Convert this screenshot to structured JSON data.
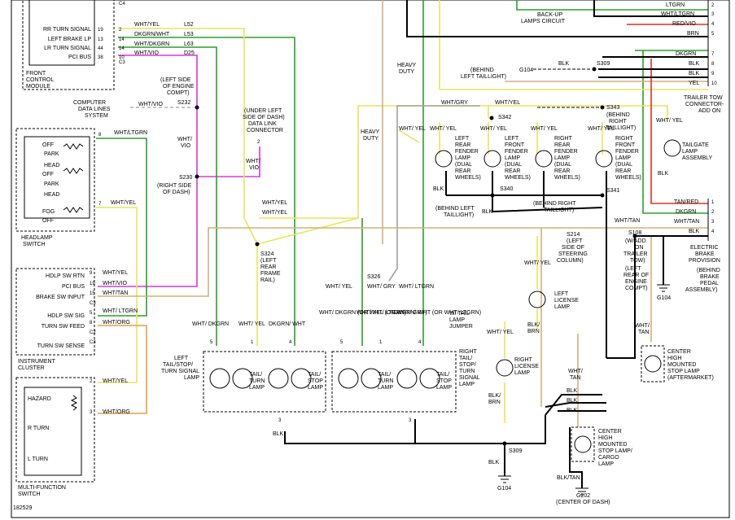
{
  "colors": {
    "wht_yel": "#e8e65a",
    "wht_grn": "#2aa02a",
    "wht_vio": "#d838d8",
    "wht_gry": "#a0a0a0",
    "wht_org": "#e8a040",
    "wht_tan": "#d2b07a",
    "red": "#e03020",
    "blk": "#000000"
  },
  "labels": {
    "front_control_module": [
      "FRONT",
      "CONTROL",
      "MODULE"
    ],
    "fcm_pins": [
      {
        "name": "RR TURN SIGNAL",
        "pin": "19",
        "num": "2"
      },
      {
        "name": "LEFT BRAKE LP",
        "pin": "13",
        "num": "14"
      },
      {
        "name": "LR TURN SIGNAL",
        "pin": "44",
        "num": "14"
      },
      {
        "name": "PCI BUS",
        "pin": "38",
        "num": "10"
      }
    ],
    "c4": "C4",
    "c3": "C3",
    "fcm_wires": [
      {
        "color": "WHT/YEL",
        "code": "L52"
      },
      {
        "color": "DKGRN/WHT",
        "code": "L53"
      },
      {
        "color": "WHT/DKGRN",
        "code": "L63"
      },
      {
        "color": "WHT/VIO",
        "code": "D25"
      }
    ],
    "left_side_engine": [
      "(LEFT SIDE",
      "OF ENGINE",
      "COMPT)"
    ],
    "s232": "S232",
    "computer_data_lines": [
      "COMPUTER",
      "DATA LINES",
      "SYSTEM"
    ],
    "wht_vio": "WHT/VIO",
    "wht_vio_stack": [
      "WHT/",
      "VIO"
    ],
    "s230": "S230",
    "right_side_dash": [
      "(RIGHT SIDE",
      "OF DASH)"
    ],
    "data_link": [
      "(UNDER LEFT",
      "SIDE OF DASH)",
      "DATA LINK",
      "CONNECTOR"
    ],
    "dlc_pin": "2",
    "heavy_duty_1": [
      "HEAVY",
      "DUTY"
    ],
    "heavy_duty_2": [
      "HEAVY",
      "DUTY"
    ],
    "backup_lamps": [
      "BACK-UP",
      "LAMPS CIRCUIT"
    ],
    "g104": "G104",
    "s309": "S309",
    "blk": "BLK",
    "behind_left_taillight": [
      "(BEHIND",
      "LEFT TAILLIGHT)"
    ],
    "wht_gry": "WHT/GRY",
    "wht_yel": "WHT/YEL",
    "s342": "S342",
    "s343": "S343",
    "behind_right_taillight": [
      "(BEHIND",
      "RIGHT",
      "TAILLIGHT)"
    ],
    "trailer_tow_connector": [
      "TRAILER TOW",
      "CONNECTOR-",
      "ADD ON"
    ],
    "trailer_pins": [
      {
        "color": "LTGRN",
        "pin": "2"
      },
      {
        "color": "WHT/LTGRN",
        "pin": "3"
      },
      {
        "color": "RED/VIO",
        "pin": "4"
      },
      {
        "color": "BRN",
        "pin": "5"
      },
      {
        "color": "DKGRN",
        "pin": "7"
      },
      {
        "color": "BLK",
        "pin": "8"
      },
      {
        "color": "BLK",
        "pin": "9"
      },
      {
        "color": "YEL",
        "pin": "10"
      }
    ],
    "left_rear_fender": [
      "LEFT",
      "REAR",
      "FENDER",
      "LAMP",
      "(DUAL",
      "REAR",
      "WHEELS)"
    ],
    "left_front_fender": [
      "LEFT",
      "FRONT",
      "FENDER",
      "LAMP",
      "(DUAL",
      "REAR",
      "WHEELS)"
    ],
    "right_rear_fender": [
      "RIGHT",
      "REAR",
      "FENDER",
      "LAMP",
      "(DUAL",
      "REAR",
      "WHEELS)"
    ],
    "right_front_fender": [
      "RIGHT",
      "FRONT",
      "FENDER",
      "LAMP",
      "(DUAL",
      "REAR",
      "WHEELS)"
    ],
    "tailgate_lamp": [
      "TAILGATE",
      "LAMP",
      "ASSEMBLY"
    ],
    "s340": "S340",
    "s341": "S341",
    "behind_left_taillight_2": [
      "(BEHIND LEFT",
      "TAILLIGHT)"
    ],
    "behind_right_taillight_2": [
      "(BEHIND RIGHT",
      "TAILLIGHT)"
    ],
    "trailer_pins_lower": [
      {
        "color": "TAN/RED",
        "pin": "1"
      },
      {
        "color": "DKGRN",
        "pin": "2"
      },
      {
        "color": "WHT/TAN",
        "pin": "3"
      },
      {
        "color": "BLK",
        "pin": "4"
      }
    ],
    "headlamp_switch": [
      "HEADLAMP",
      "SWITCH"
    ],
    "headlamp_positions": [
      "OFF",
      "PARK",
      "HEAD",
      "OFF",
      "PARK",
      "HEAD",
      "FOG",
      "OFF"
    ],
    "hs_pin8": "8",
    "hs_pin7": "7",
    "wht_ltgrn": "WHT/LTGRN",
    "instrument_cluster": [
      "INSTRUMENT",
      "CLUSTER"
    ],
    "ic_pins": [
      {
        "name": "HDLP SW RTN",
        "pin": "9",
        "wire": "WHT/YEL"
      },
      {
        "name": "PCI BUS",
        "pin": "19",
        "wire": "WHT/VIO"
      },
      {
        "name": "BRAKE SW INPUT",
        "pin": "15",
        "wire": "WHT/TAN"
      },
      {
        "name": "HDLP SW SIG",
        "pin": "5",
        "wire": "WHT/ LTGRN"
      },
      {
        "name": "TURN SW FEED",
        "pin": "8",
        "wire": "WHT/ORG"
      },
      {
        "name": "TURN SW SENSE",
        "pin": "",
        "wire": ""
      }
    ],
    "ic_connectors": [
      "C1",
      "C3",
      "C2",
      "C3"
    ],
    "multi_function_switch": [
      "MULTI-FUNCTION",
      "SWITCH"
    ],
    "mf_labels": [
      "HAZARD",
      "R TURN",
      "L TURN"
    ],
    "mf_pins": [
      {
        "pin": "2",
        "wire": "WHT/YEL"
      },
      {
        "pin": "3",
        "wire": "WHT/ORG"
      }
    ],
    "s324": [
      "S324",
      "(LEFT",
      "REAR",
      "FRAME",
      "RAIL)"
    ],
    "s326": "S326",
    "left_tail_stop": [
      "LEFT",
      "TAIL/STOP/",
      "TURN SIGNAL",
      "LAMP"
    ],
    "right_tail_stop": [
      "RIGHT",
      "TAIL/",
      "STOP/",
      "TURN",
      "SIGNAL",
      "LAMP"
    ],
    "tail_turn": [
      "TAIL/",
      "TURN",
      "LAMP"
    ],
    "tail_stop": [
      "TAIL/",
      "STOP",
      "LAMP"
    ],
    "wt_tail_lamp_jumper": [
      "W/ TAIL",
      "LAMP",
      "JUMPER"
    ],
    "left_tail_wires": [
      {
        "color": "WHT/ DKGRN",
        "pin": "5"
      },
      {
        "color": "WHT/ YEL",
        "pin": "1"
      },
      {
        "color": "DKGRN/ WHT",
        "pin": "4"
      }
    ],
    "right_tail_wires": [
      {
        "color": "WHT/ DKGRN (OR WHT/ LTGRN)",
        "pin": "5"
      },
      {
        "color": "WHT/ YEL (OR WHT/ GRY)",
        "pin": "1"
      },
      {
        "color": "DKGRN/ WHT (OR WHT/ LTGRN)",
        "pin": "4"
      }
    ],
    "jumper_wires": [
      "WHT/ YEL",
      "WHT/ GRY",
      "WHT/ LTGRN"
    ],
    "s214": [
      "S214",
      "(LEFT",
      "SIDE OF",
      "STEERING",
      "COLUMN)"
    ],
    "left_license_lamp": [
      "LEFT",
      "LICENSE",
      "LAMP"
    ],
    "right_license_lamp": [
      "RIGHT",
      "LICENSE",
      "LAMP"
    ],
    "blk_brn": [
      "BLK/",
      "BRN"
    ],
    "s108": [
      "S108",
      "(W/ADD",
      "ON",
      "TRAILER",
      "TOW)",
      "(LEFT",
      "REAR OF",
      "ENGINE",
      "COMPT)"
    ],
    "electric_brake": [
      "ELECTRIC",
      "BRAKE",
      "PROVISION",
      "(BEHIND",
      "BRAKE",
      "PEDAL",
      "ASSEMBLY)"
    ],
    "chmsl_aftermarket": [
      "CENTER",
      "HIGH",
      "MOUNTED",
      "STOP LAMP",
      "(AFTERMARKET)"
    ],
    "chmsl_cargo": [
      "CENTER",
      "HIGH",
      "MOUNTED",
      "STOP LAMP/",
      "CARGO",
      "LAMP"
    ],
    "blk_tan": "BLK/TAN",
    "g202": [
      "G202",
      "(CENTER OF DASH)"
    ],
    "wht_tan_stack": [
      "WHT/",
      "TAN"
    ],
    "figure_id": "182529",
    "pin_numbers": [
      "1",
      "2",
      "3",
      "4",
      "5"
    ]
  }
}
